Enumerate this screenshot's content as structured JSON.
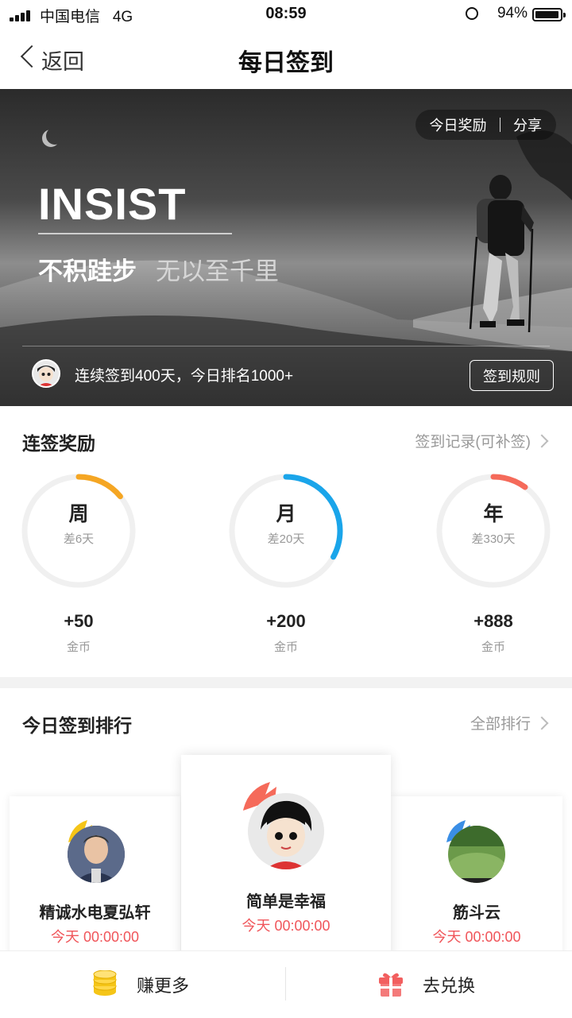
{
  "status_bar": {
    "carrier": "中国电信",
    "network": "4G",
    "time": "08:59",
    "battery": "94%"
  },
  "nav": {
    "back_label": "返回",
    "title": "每日签到"
  },
  "banner": {
    "actions": [
      "今日奖励",
      "分享"
    ],
    "headline": "INSIST",
    "slogan_main": "不积跬步",
    "slogan_sub": "无以至千里",
    "streak_text": "连续签到400天，今日排名1000+",
    "rules_button": "签到规则"
  },
  "rewards": {
    "title": "连签奖励",
    "link": "签到记录(可补签)",
    "items": [
      {
        "label": "周",
        "diff": "差6天",
        "coins": "+50",
        "unit": "金币",
        "progress": 0.14,
        "color": "#f5a623"
      },
      {
        "label": "月",
        "diff": "差20天",
        "coins": "+200",
        "unit": "金币",
        "progress": 0.33,
        "color": "#1aa5ea"
      },
      {
        "label": "年",
        "diff": "差330天",
        "coins": "+888",
        "unit": "金币",
        "progress": 0.1,
        "color": "#f56a5a"
      }
    ]
  },
  "ranking": {
    "title": "今日签到排行",
    "link": "全部排行",
    "entries": [
      {
        "name": "精诚水电夏弘轩",
        "time": "今天 00:00:00",
        "crown_color": "#f5c518"
      },
      {
        "name": "简单是幸福",
        "time": "今天 00:00:00",
        "crown_color": "#f56a5a"
      },
      {
        "name": "筋斗云",
        "time": "今天 00:00:00",
        "crown_color": "#3a8ee6"
      }
    ]
  },
  "tabbar": {
    "earn": "赚更多",
    "redeem": "去兑换"
  }
}
